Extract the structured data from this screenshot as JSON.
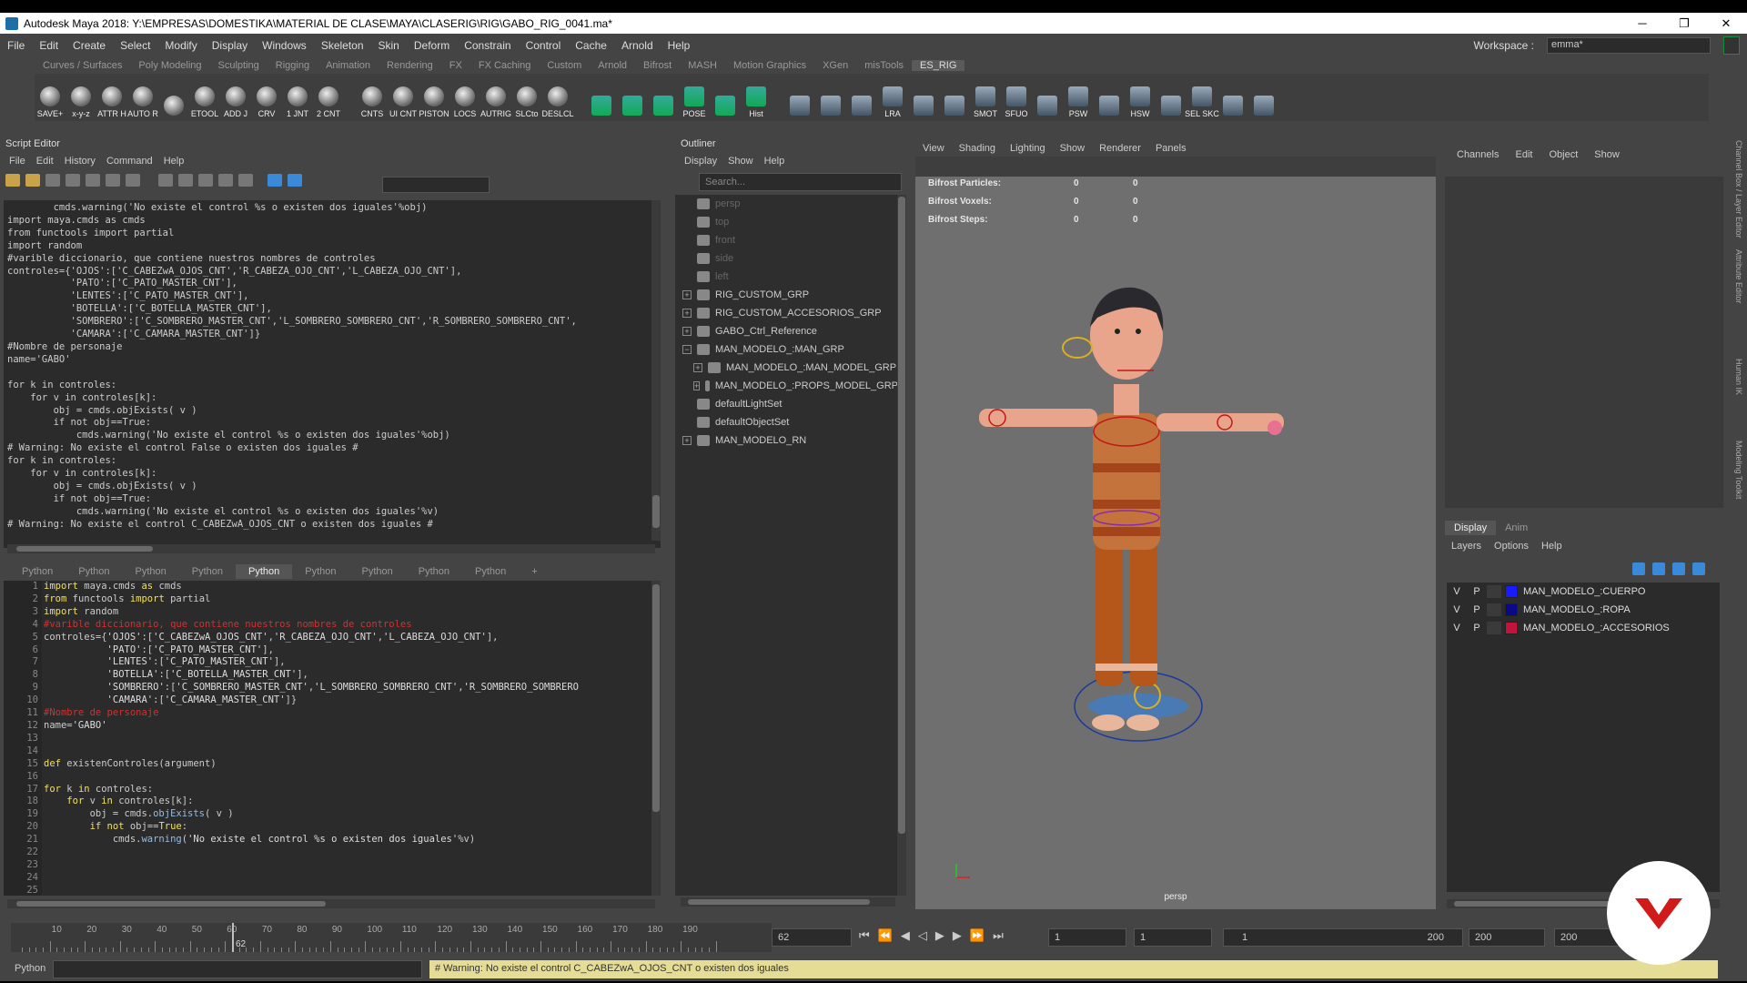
{
  "window": {
    "title": "Autodesk Maya 2018: Y:\\EMPRESAS\\DOMESTIKA\\MATERIAL DE CLASE\\MAYA\\CLASERIG\\RIG\\GABO_RIG_0041.ma*",
    "minimize": "─",
    "maximize": "❐",
    "close": "✕"
  },
  "menu": [
    "File",
    "Edit",
    "Create",
    "Select",
    "Modify",
    "Display",
    "Windows",
    "Skeleton",
    "Skin",
    "Deform",
    "Constrain",
    "Control",
    "Cache",
    "Arnold",
    "Help"
  ],
  "workspace": {
    "label": "Workspace :",
    "value": "emma*"
  },
  "shelf_tabs": [
    "Curves / Surfaces",
    "Poly Modeling",
    "Sculpting",
    "Rigging",
    "Animation",
    "Rendering",
    "FX",
    "FX Caching",
    "Custom",
    "Arnold",
    "Bifrost",
    "MASH",
    "Motion Graphics",
    "XGen",
    "misTools",
    "ES_RIG"
  ],
  "shelf_active": "ES_RIG",
  "shelf_buttons_a": [
    "SAVE+",
    "x-y-z",
    "ATTR H",
    "AUTO R",
    "",
    "ETOOL",
    "ADD J",
    "CRV",
    "1 JNT",
    "2 CNT"
  ],
  "shelf_buttons_b": [
    "CNTS",
    "UI CNT",
    "PISTON",
    "LOCS",
    "AUTRIG",
    "SLCto",
    "DESLCL"
  ],
  "shelf_buttons_c": [
    "",
    "",
    "",
    "POSE",
    "",
    "Hist"
  ],
  "shelf_buttons_d": [
    "",
    "",
    "",
    "LRA",
    "",
    "",
    "SMOT",
    "SFUO",
    "",
    "PSW",
    "",
    "HSW",
    "",
    "SEL SKC",
    "",
    ""
  ],
  "script_editor": {
    "title": "Script Editor",
    "menu": [
      "File",
      "Edit",
      "History",
      "Command",
      "Help"
    ],
    "history": [
      "        cmds.warning('No existe el control %s o existen dos iguales'%obj)",
      "import maya.cmds as cmds",
      "from functools import partial",
      "import random",
      "#varible diccionario, que contiene nuestros nombres de controles",
      "controles={'OJOS':['C_CABEZwA_OJOS_CNT','R_CABEZA_OJO_CNT','L_CABEZA_OJO_CNT'],",
      "           'PATO':['C_PATO_MASTER_CNT'],",
      "           'LENTES':['C_PATO_MASTER_CNT'],",
      "           'BOTELLA':['C_BOTELLA_MASTER_CNT'],",
      "           'SOMBRERO':['C_SOMBRERO_MASTER_CNT','L_SOMBRERO_SOMBRERO_CNT','R_SOMBRERO_SOMBRERO_CNT',",
      "           'CAMARA':['C_CAMARA_MASTER_CNT']}",
      "#Nombre de personaje",
      "name='GABO'",
      "",
      "for k in controles:",
      "    for v in controles[k]:",
      "        obj = cmds.objExists( v )",
      "        if not obj==True:",
      "            cmds.warning('No existe el control %s o existen dos iguales'%obj)",
      "# Warning: No existe el control False o existen dos iguales #",
      "for k in controles:",
      "    for v in controles[k]:",
      "        obj = cmds.objExists( v )",
      "        if not obj==True:",
      "            cmds.warning('No existe el control %s o existen dos iguales'%v)",
      "# Warning: No existe el control C_CABEZwA_OJOS_CNT o existen dos iguales #"
    ],
    "tabs": [
      "Python",
      "Python",
      "Python",
      "Python",
      "Python",
      "Python",
      "Python",
      "Python",
      "Python",
      "+"
    ],
    "active_tab_index": 4,
    "code": [
      {
        "n": "1",
        "segs": [
          [
            "kw",
            "import"
          ],
          [
            "t",
            " maya.cmds "
          ],
          [
            "kw",
            "as"
          ],
          [
            "t",
            " cmds"
          ]
        ]
      },
      {
        "n": "2",
        "segs": [
          [
            "kw",
            "from"
          ],
          [
            "t",
            " functools "
          ],
          [
            "kw",
            "import"
          ],
          [
            "t",
            " partial"
          ]
        ]
      },
      {
        "n": "3",
        "segs": [
          [
            "kw",
            "import"
          ],
          [
            "t",
            " random"
          ]
        ]
      },
      {
        "n": "4",
        "segs": [
          [
            "cm",
            "#varible diccionario, que contiene nuestros nombres de controles"
          ]
        ]
      },
      {
        "n": "5",
        "segs": [
          [
            "t",
            "controles={"
          ],
          [
            "st",
            "'OJOS'"
          ],
          [
            "t",
            ":["
          ],
          [
            "st",
            "'C_CABEZwA_OJOS_CNT'"
          ],
          [
            "t",
            ","
          ],
          [
            "st",
            "'R_CABEZA_OJO_CNT'"
          ],
          [
            "t",
            ","
          ],
          [
            "st",
            "'L_CABEZA_OJO_CNT'"
          ],
          [
            "t",
            "],"
          ]
        ]
      },
      {
        "n": "6",
        "segs": [
          [
            "t",
            "           "
          ],
          [
            "st",
            "'PATO'"
          ],
          [
            "t",
            ":["
          ],
          [
            "st",
            "'C_PATO_MASTER_CNT'"
          ],
          [
            "t",
            "],"
          ]
        ]
      },
      {
        "n": "7",
        "segs": [
          [
            "t",
            "           "
          ],
          [
            "st",
            "'LENTES'"
          ],
          [
            "t",
            ":["
          ],
          [
            "st",
            "'C_PATO_MASTER_CNT'"
          ],
          [
            "t",
            "],"
          ]
        ]
      },
      {
        "n": "8",
        "segs": [
          [
            "t",
            "           "
          ],
          [
            "st",
            "'BOTELLA'"
          ],
          [
            "t",
            ":["
          ],
          [
            "st",
            "'C_BOTELLA_MASTER_CNT'"
          ],
          [
            "t",
            "],"
          ]
        ]
      },
      {
        "n": "9",
        "segs": [
          [
            "t",
            "           "
          ],
          [
            "st",
            "'SOMBRERO'"
          ],
          [
            "t",
            ":["
          ],
          [
            "st",
            "'C_SOMBRERO_MASTER_CNT'"
          ],
          [
            "t",
            ","
          ],
          [
            "st",
            "'L_SOMBRERO_SOMBRERO_CNT'"
          ],
          [
            "t",
            ","
          ],
          [
            "st",
            "'R_SOMBRERO_SOMBRERO"
          ]
        ]
      },
      {
        "n": "10",
        "segs": [
          [
            "t",
            "           "
          ],
          [
            "st",
            "'CAMARA'"
          ],
          [
            "t",
            ":["
          ],
          [
            "st",
            "'C_CAMARA_MASTER_CNT'"
          ],
          [
            "t",
            "]}"
          ]
        ]
      },
      {
        "n": "11",
        "segs": [
          [
            "cm",
            "#Nombre de personaje"
          ]
        ]
      },
      {
        "n": "12",
        "segs": [
          [
            "t",
            "name="
          ],
          [
            "st",
            "'GABO'"
          ]
        ]
      },
      {
        "n": "13",
        "segs": []
      },
      {
        "n": "14",
        "segs": []
      },
      {
        "n": "15",
        "segs": [
          [
            "kw",
            "def"
          ],
          [
            "t",
            " existenControles(argument)"
          ]
        ]
      },
      {
        "n": "16",
        "segs": []
      },
      {
        "n": "17",
        "segs": [
          [
            "kw",
            "for"
          ],
          [
            "t",
            " k "
          ],
          [
            "kw",
            "in"
          ],
          [
            "t",
            " controles:"
          ]
        ]
      },
      {
        "n": "18",
        "segs": [
          [
            "t",
            "    "
          ],
          [
            "kw",
            "for"
          ],
          [
            "t",
            " v "
          ],
          [
            "kw",
            "in"
          ],
          [
            "t",
            " controles[k]:"
          ]
        ]
      },
      {
        "n": "19",
        "segs": [
          [
            "t",
            "        obj = cmds."
          ],
          [
            "fn",
            "objExists"
          ],
          [
            "t",
            "( v )"
          ]
        ]
      },
      {
        "n": "20",
        "segs": [
          [
            "t",
            "        "
          ],
          [
            "kw",
            "if not"
          ],
          [
            "t",
            " obj=="
          ],
          [
            "kw",
            "True"
          ],
          [
            "t",
            ":"
          ]
        ]
      },
      {
        "n": "21",
        "segs": [
          [
            "t",
            "            cmds."
          ],
          [
            "fn",
            "warning"
          ],
          [
            "t",
            "("
          ],
          [
            "st",
            "'No existe el control %s o existen dos iguales'"
          ],
          [
            "t",
            "%v)"
          ]
        ]
      },
      {
        "n": "22",
        "segs": []
      },
      {
        "n": "23",
        "segs": []
      },
      {
        "n": "24",
        "segs": []
      },
      {
        "n": "25",
        "segs": []
      }
    ]
  },
  "outliner": {
    "title": "Outliner",
    "menu": [
      "Display",
      "Show",
      "Help"
    ],
    "search_placeholder": "Search...",
    "items": [
      {
        "label": "persp",
        "dim": true,
        "exp": "",
        "indent": 0
      },
      {
        "label": "top",
        "dim": true,
        "exp": "",
        "indent": 0
      },
      {
        "label": "front",
        "dim": true,
        "exp": "",
        "indent": 0
      },
      {
        "label": "side",
        "dim": true,
        "exp": "",
        "indent": 0
      },
      {
        "label": "left",
        "dim": true,
        "exp": "",
        "indent": 0
      },
      {
        "label": "RIG_CUSTOM_GRP",
        "dim": false,
        "exp": "+",
        "indent": 0
      },
      {
        "label": "RIG_CUSTOM_ACCESORIOS_GRP",
        "dim": false,
        "exp": "+",
        "indent": 0
      },
      {
        "label": "GABO_Ctrl_Reference",
        "dim": false,
        "exp": "+",
        "indent": 0
      },
      {
        "label": "MAN_MODELO_:MAN_GRP",
        "dim": false,
        "exp": "−",
        "indent": 0
      },
      {
        "label": "MAN_MODELO_:MAN_MODEL_GRP",
        "dim": false,
        "exp": "+",
        "indent": 1
      },
      {
        "label": "MAN_MODELO_:PROPS_MODEL_GRP",
        "dim": false,
        "exp": "+",
        "indent": 1
      },
      {
        "label": "defaultLightSet",
        "dim": false,
        "exp": "",
        "indent": 0
      },
      {
        "label": "defaultObjectSet",
        "dim": false,
        "exp": "",
        "indent": 0
      },
      {
        "label": "MAN_MODELO_RN",
        "dim": false,
        "exp": "+",
        "indent": 0
      }
    ]
  },
  "viewport": {
    "menu": [
      "View",
      "Shading",
      "Lighting",
      "Show",
      "Renderer",
      "Panels"
    ],
    "hud": [
      {
        "label": "Bifrost Particles:",
        "a": "0",
        "b": "0"
      },
      {
        "label": "Bifrost Voxels:",
        "a": "0",
        "b": "0"
      },
      {
        "label": "Bifrost Steps:",
        "a": "0",
        "b": "0"
      }
    ],
    "camera": "persp"
  },
  "channel_box": {
    "menu": [
      "Channels",
      "Edit",
      "Object",
      "Show"
    ]
  },
  "layer_editor": {
    "tabs": [
      "Display",
      "Anim"
    ],
    "menu": [
      "Layers",
      "Options",
      "Help"
    ],
    "layers": [
      {
        "v": "V",
        "p": "P",
        "name": "MAN_MODELO_:CUERPO",
        "color": "#1a1aff"
      },
      {
        "v": "V",
        "p": "P",
        "name": "MAN_MODELO_:ROPA",
        "color": "#0a0a88"
      },
      {
        "v": "V",
        "p": "P",
        "name": "MAN_MODELO_:ACCESORIOS",
        "color": "#c0143c"
      }
    ]
  },
  "side_tabs": [
    "Channel Box / Layer Editor",
    "Attribute Editor",
    "Human IK",
    "Modeling Toolkit"
  ],
  "timeline": {
    "ticks": [
      "10",
      "20",
      "30",
      "40",
      "50",
      "60",
      "70",
      "80",
      "90",
      "100",
      "110",
      "120",
      "130",
      "140",
      "150",
      "160",
      "170",
      "180",
      "190"
    ],
    "current_frame": "62",
    "frame_field": "62",
    "range_start": "1",
    "range_inner_start": "1",
    "slider_start": "1",
    "slider_end": "200",
    "range_end": "200",
    "anim_end": "200"
  },
  "command_line": {
    "label": "Python",
    "message": "# Warning: No existe el control C_CABEZwA_OJOS_CNT o existen dos iguales"
  },
  "colors": {
    "brand_logo": "#d11a1a",
    "warn_bg": "#e5dc95"
  }
}
